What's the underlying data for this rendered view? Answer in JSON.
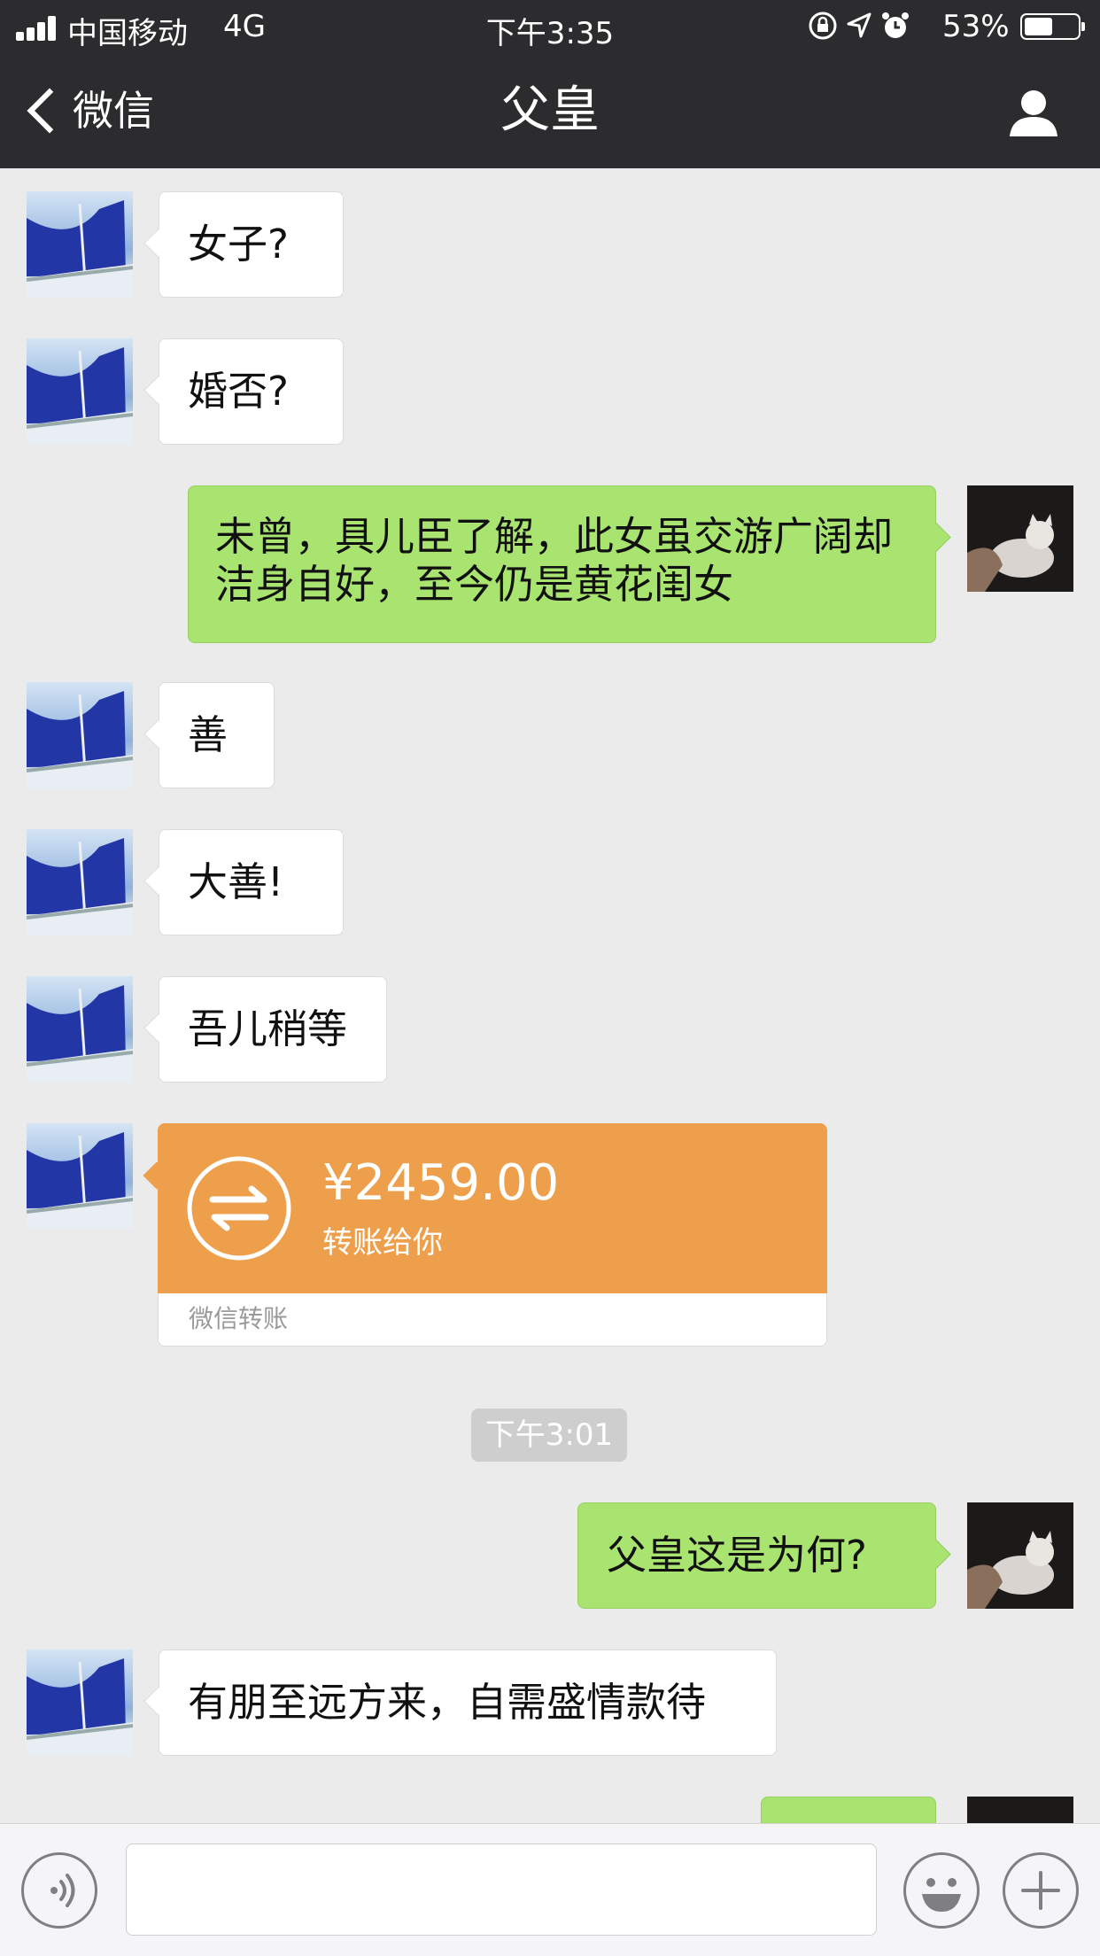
{
  "status_bar": {
    "carrier": "中国移动",
    "network": "4G",
    "time": "下午3:35",
    "battery": "53%",
    "battery_level": 0.53,
    "icons": [
      "orientation-lock-icon",
      "location-icon",
      "alarm-icon"
    ]
  },
  "nav": {
    "back_label": "微信",
    "title": "父皇",
    "right_icon": "profile-icon"
  },
  "messages": [
    {
      "sender": "father",
      "text": "女子?"
    },
    {
      "sender": "father",
      "text": "婚否?"
    },
    {
      "sender": "me",
      "text": "未曾，具儿臣了解，此女虽交游广阔却洁身自好，至今仍是黄花闺女"
    },
    {
      "sender": "father",
      "text": "善"
    },
    {
      "sender": "father",
      "text": "大善!"
    },
    {
      "sender": "father",
      "text": "吾儿稍等"
    },
    {
      "sender": "father",
      "type": "transfer",
      "amount": "¥2459.00",
      "description": "转账给你",
      "footer": "微信转账"
    },
    {
      "type": "timestamp",
      "text": "下午3:01"
    },
    {
      "sender": "me",
      "text": "父皇这是为何?"
    },
    {
      "sender": "father",
      "text": "有朋至远方来，自需盛情款待"
    },
    {
      "sender": "me",
      "text": ""
    }
  ],
  "input_bar": {
    "value": "",
    "icons": [
      "voice-icon",
      "emoji-icon",
      "plus-icon"
    ]
  },
  "colors": {
    "nav_bg": "#2c2c2e",
    "chat_bg": "#ebebeb",
    "my_bubble": "#a9e470",
    "their_bubble": "#ffffff",
    "transfer": "#ee9f4c"
  }
}
